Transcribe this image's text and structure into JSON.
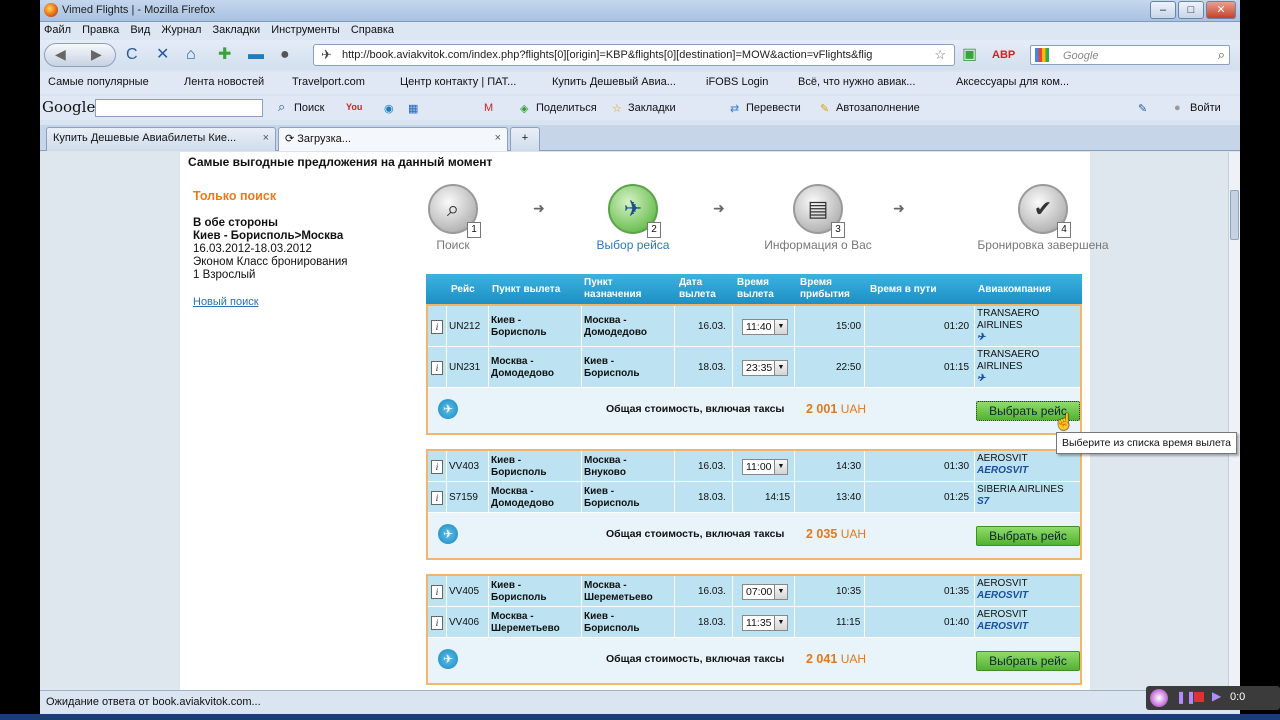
{
  "window": {
    "title": "Vimed Flights | - Mozilla Firefox",
    "min": "–",
    "max": "□",
    "close": "✕"
  },
  "menu": [
    "Файл",
    "Правка",
    "Вид",
    "Журнал",
    "Закладки",
    "Инструменты",
    "Справка"
  ],
  "nav": {
    "url": "http://book.aviakvitok.com/index.php?flights[0][origin]=KBP&flights[0][destination]=MOW&action=vFlights&flig",
    "search_placeholder": "Google",
    "back_icon": "back-icon",
    "reload": "C",
    "stop": "✕",
    "home": "⌂"
  },
  "bookmarks": [
    "Самые популярные",
    "Лента новостей",
    "Travelport.com",
    "Центр контакту | ПАТ...",
    "Купить Дешевый Авиа...",
    "iFOBS Login",
    "Всё, что нужно авиак...",
    "Аксессуары для ком..."
  ],
  "google_toolbar": {
    "logo": "Google",
    "search": "Поиск",
    "share": "Поделиться",
    "bookmarks": "Закладки",
    "translate": "Перевести",
    "autofill": "Автозаполнение",
    "login": "Войти"
  },
  "tabs": [
    {
      "label": "Купить Дешевые Авиабилеты Кие...",
      "close": "×"
    },
    {
      "label": "Загрузка...",
      "close": "×"
    },
    {
      "label": "+"
    }
  ],
  "page": {
    "heading": "Самые выгодные предложения на данный момент",
    "sidebar": {
      "mode": "Только поиск",
      "trip_type": "В обе стороны",
      "route": "Киев - Борисполь>Москва",
      "dates": "16.03.2012-18.03.2012",
      "class": "Эконом Класс бронирования",
      "passengers": "1 Взрослый",
      "new_search": "Новый поиск"
    },
    "steps": [
      {
        "num": "1",
        "label": "Поиск",
        "icon": "magnifier-icon"
      },
      {
        "num": "2",
        "label": "Выбор рейса",
        "icon": "airplane-icon"
      },
      {
        "num": "3",
        "label": "Информация о Вас",
        "icon": "passenger-icon"
      },
      {
        "num": "4",
        "label": "Бронировка завершена",
        "icon": "checkmark-icon"
      }
    ],
    "columns": {
      "flight": "Рейс",
      "from_1": "Пункт вылета",
      "to_1": "Пункт",
      "to_2": "назначения",
      "date_1": "Дата",
      "date_2": "вылета",
      "dep_1": "Время",
      "dep_2": "вылета",
      "arr_1": "Время",
      "arr_2": "прибытия",
      "dur": "Время в пути",
      "airline": "Авиакомпания"
    },
    "total_label": "Общая стоимость, включая таксы",
    "currency": "UAH",
    "select_button": "Выбрать рейс",
    "tooltip": "Выберите из списка время вылета",
    "offers": [
      {
        "price": "2 001",
        "rows": [
          {
            "flight": "UN212",
            "from_1": "Киев -",
            "from_2": "Борисполь",
            "to_1": "Москва -",
            "to_2": "Домодедово",
            "date": "16.03.",
            "dep": "11:40",
            "dep_select": true,
            "arr": "15:00",
            "dur": "01:20",
            "airline_1": "TRANSAERO",
            "airline_2": "AIRLINES",
            "logo": "✈"
          },
          {
            "flight": "UN231",
            "from_1": "Москва -",
            "from_2": "Домодедово",
            "to_1": "Киев -",
            "to_2": "Борисполь",
            "date": "18.03.",
            "dep": "23:35",
            "dep_select": true,
            "arr": "22:50",
            "dur": "01:15",
            "airline_1": "TRANSAERO",
            "airline_2": "AIRLINES",
            "logo": "✈"
          }
        ]
      },
      {
        "price": "2 035",
        "rows": [
          {
            "flight": "VV403",
            "from_1": "Киев -",
            "from_2": "Борисполь",
            "to_1": "Москва -",
            "to_2": "Внуково",
            "date": "16.03.",
            "dep": "11:00",
            "dep_select": true,
            "arr": "14:30",
            "dur": "01:30",
            "airline_1": "AEROSVIT",
            "airline_2": "",
            "logo": "AeroSvit"
          },
          {
            "flight": "S7159",
            "from_1": "Москва -",
            "from_2": "Домодедово",
            "to_1": "Киев -",
            "to_2": "Борисполь",
            "date": "18.03.",
            "dep": "14:15",
            "dep_select": false,
            "arr": "13:40",
            "dur": "01:25",
            "airline_1": "SIBERIA AIRLINES",
            "airline_2": "",
            "logo": "S7"
          }
        ]
      },
      {
        "price": "2 041",
        "rows": [
          {
            "flight": "VV405",
            "from_1": "Киев -",
            "from_2": "Борисполь",
            "to_1": "Москва -",
            "to_2": "Шереметьево",
            "date": "16.03.",
            "dep": "07:00",
            "dep_select": true,
            "arr": "10:35",
            "dur": "01:35",
            "airline_1": "AEROSVIT",
            "airline_2": "",
            "logo": "AeroSvit"
          },
          {
            "flight": "VV406",
            "from_1": "Москва -",
            "from_2": "Шереметьево",
            "to_1": "Киев -",
            "to_2": "Борисполь",
            "date": "18.03.",
            "dep": "11:35",
            "dep_select": true,
            "arr": "11:15",
            "dur": "01:40",
            "airline_1": "AEROSVIT",
            "airline_2": "",
            "logo": "AeroSvit"
          }
        ]
      }
    ]
  },
  "status": "Ожидание ответа от book.aviakvitok.com...",
  "recorder": {
    "time": "0:0"
  }
}
